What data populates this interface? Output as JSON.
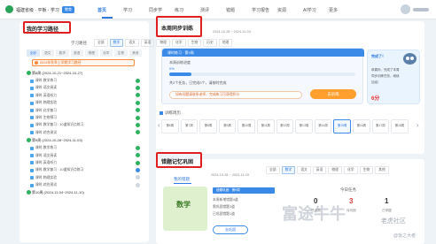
{
  "topbar": {
    "logo_text": "福建省级 · 平板 · 学习",
    "badge": "教育",
    "nav": [
      "首页",
      "学习",
      "同步学",
      "练习",
      "测评",
      "错题",
      "学习报告",
      "资源",
      "AI学习",
      "更多"
    ],
    "active_nav_index": 0
  },
  "left_panel": {
    "title": "我的学习路径",
    "subtitle": "学习路径",
    "tabs": [
      "全部",
      "语文",
      "数学",
      "英语",
      "物理",
      "化学",
      "生物",
      "其他"
    ],
    "active_tab_index": 0,
    "filter_text": "2024年秋季上学期学习路径",
    "weeks": [
      {
        "label": "第8周 (2024-10-21~2024-10-27)",
        "rows": [
          {
            "label": "课时-数学练习",
            "status": "done"
          },
          {
            "label": "课时-语文阅读",
            "status": "done"
          },
          {
            "label": "课时-英语听力",
            "status": "done"
          },
          {
            "label": "课时-物理实验",
            "status": "done"
          },
          {
            "label": "课时-化学复习",
            "status": "done"
          },
          {
            "label": "课时-生物预习",
            "status": "done"
          },
          {
            "label": "课时-数学复习 · 10道知识点练习",
            "status": "done"
          },
          {
            "label": "课时-综合测试",
            "status": "done"
          }
        ]
      },
      {
        "label": "第9周 (2024-10-28~2024-11-03)",
        "rows": [
          {
            "label": "课时-数学练习",
            "status": "done"
          },
          {
            "label": "课时-语文阅读",
            "status": "done"
          },
          {
            "label": "课时-英语听力",
            "status": "done"
          },
          {
            "label": "课时-数学复习 · 10道知识点练习",
            "status": "progress"
          },
          {
            "label": "课时-物理实验",
            "status": "todo"
          },
          {
            "label": "课时-综合测试",
            "status": "todo"
          }
        ]
      },
      {
        "label": "第10周 (2024-11-04~2024-11-10)",
        "rows": []
      }
    ]
  },
  "sync_training": {
    "title": "本周同步训练",
    "date_range": "2024-10-28 ~ 2024-11-03",
    "tabs": [
      "全部",
      "数学",
      "语文",
      "英语",
      "物理",
      "化学",
      "生物",
      "历史",
      "地理"
    ],
    "active_tab_index": 1,
    "task_header": "课时练习 · 第9周",
    "task_line_1": "本周训练进度",
    "progress": 0.12,
    "progress_text": "0%",
    "task_line_2": "共2个任务，已完成0个，请按时完成",
    "pill_text": "如有问题请联系老师，完成练习可获得积分",
    "button_label": "去训练",
    "side_card": {
      "title": "完成了！",
      "line1": "恭喜你，完成了本周",
      "line2": "同步训练任务，继续",
      "line3": "加油！",
      "score": "6分"
    },
    "week_section_label": "训练周历",
    "weeks": [
      "第6周",
      "第7周",
      "第8周",
      "第9周",
      "第10周",
      "第11周",
      "第12周",
      "第13周",
      "第14周",
      "第15周",
      "第16周",
      "第17周",
      "第18周"
    ],
    "active_week_index": 9
  },
  "error_review": {
    "title": "错题记忆巩固",
    "tabs": [
      "全部",
      "数学",
      "语文",
      "英语",
      "物理",
      "化学",
      "生物",
      "其他"
    ],
    "active_tab_index": 1,
    "date_range": "2024-10-28 ~ 2024-11-03",
    "my_errors_label": "我的错题",
    "book_label": "数学",
    "tag": "错题巩固 · 第9周",
    "line1": "本周新增错题4道",
    "line2": "需巩固错题3道",
    "line3": "已巩固错题1道",
    "button_label": "去巩固",
    "stats_title": "今日任务",
    "stats": [
      {
        "value": "0",
        "label": "已巩固",
        "color": "#333333"
      },
      {
        "value": "3",
        "label": "待巩固",
        "color": "#e03a3a"
      },
      {
        "value": "1",
        "label": "已掌握",
        "color": "#333333"
      }
    ]
  },
  "watermark": {
    "main": "富途牛牛",
    "community": "老虎社区",
    "handle": "@饭之大者"
  }
}
